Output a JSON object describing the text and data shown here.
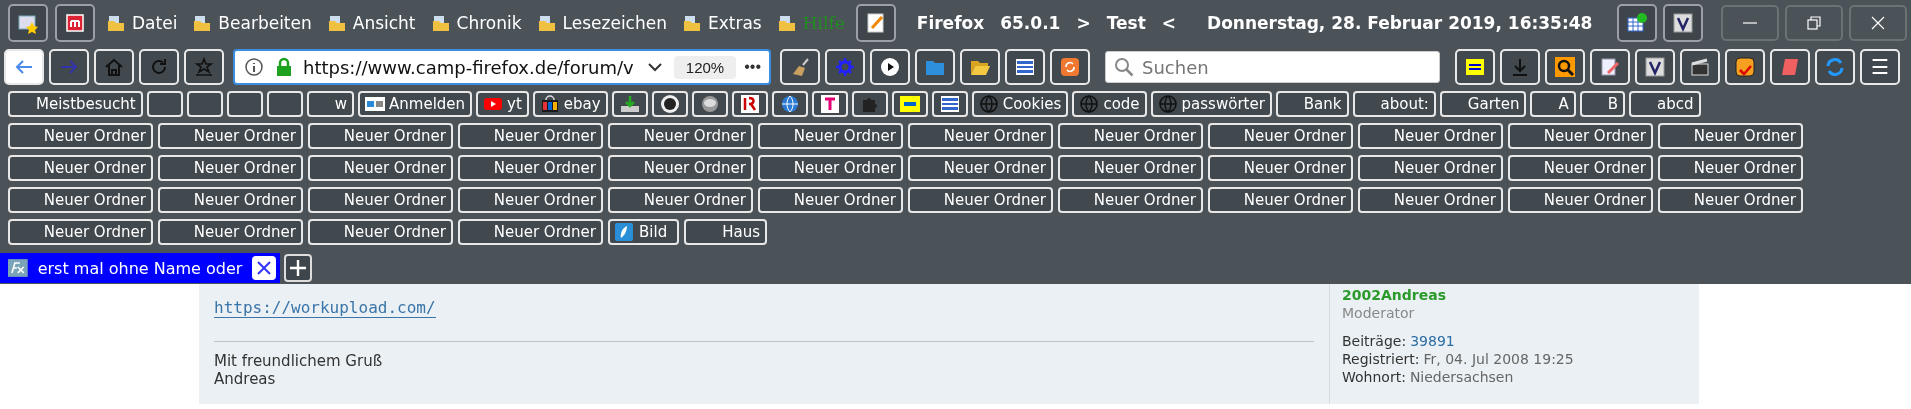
{
  "menubar": {
    "menus": [
      {
        "label": "Datei",
        "kind": "menu"
      },
      {
        "label": "Bearbeiten",
        "kind": "menu"
      },
      {
        "label": "Ansicht",
        "kind": "menu"
      },
      {
        "label": "Chronik",
        "kind": "menu"
      },
      {
        "label": "Lesezeichen",
        "kind": "menu"
      },
      {
        "label": "Extras",
        "kind": "menu"
      },
      {
        "label": "Hilfe",
        "kind": "help"
      }
    ],
    "title": {
      "app": "Firefox",
      "version": "65.0.1",
      "left_mark": ">",
      "profile": "Test",
      "right_mark": "<"
    },
    "datetime": "Donnerstag, 28. Februar 2019, 16:35:48"
  },
  "toolbar": {
    "url": "https://www.camp-firefox.de/forum/v",
    "zoom": "120%",
    "more": "•••",
    "search": {
      "placeholder": "Suchen"
    },
    "menu": "☰"
  },
  "bookmarks": [
    {
      "kind": "folder",
      "label": "Meistbesucht"
    },
    {
      "kind": "folder"
    },
    {
      "kind": "folder"
    },
    {
      "kind": "folder"
    },
    {
      "kind": "folder"
    },
    {
      "kind": "folder",
      "label": "w"
    },
    {
      "kind": "wp",
      "label": "Anmelden"
    },
    {
      "kind": "youtube",
      "label": "yt"
    },
    {
      "kind": "shop",
      "label": "ebay"
    },
    {
      "kind": "download"
    },
    {
      "kind": "github"
    },
    {
      "kind": "disc"
    },
    {
      "kind": "logo"
    },
    {
      "kind": "globe-blue"
    },
    {
      "kind": "telekom"
    },
    {
      "kind": "puzzle"
    },
    {
      "kind": "b64"
    },
    {
      "kind": "list"
    },
    {
      "kind": "globe",
      "label": "Cookies"
    },
    {
      "kind": "globe",
      "label": "code"
    },
    {
      "kind": "globe",
      "label": "passwörter"
    },
    {
      "kind": "folder",
      "label": "Bank"
    },
    {
      "kind": "folder",
      "label": "about:"
    },
    {
      "kind": "folder",
      "label": "Garten"
    },
    {
      "kind": "folder",
      "label": "A"
    },
    {
      "kind": "folder",
      "label": "B"
    },
    {
      "kind": "folder",
      "label": "abcd"
    }
  ],
  "folder_rows": [
    [
      {
        "kind": "folder",
        "label": "Neuer Ordner"
      },
      {
        "kind": "folder",
        "label": "Neuer Ordner"
      },
      {
        "kind": "folder",
        "label": "Neuer Ordner"
      },
      {
        "kind": "folder",
        "label": "Neuer Ordner"
      },
      {
        "kind": "folder",
        "label": "Neuer Ordner"
      },
      {
        "kind": "folder",
        "label": "Neuer Ordner"
      },
      {
        "kind": "folder",
        "label": "Neuer Ordner"
      },
      {
        "kind": "folder",
        "label": "Neuer Ordner"
      },
      {
        "kind": "folder",
        "label": "Neuer Ordner"
      },
      {
        "kind": "folder",
        "label": "Neuer Ordner"
      },
      {
        "kind": "folder",
        "label": "Neuer Ordner"
      },
      {
        "kind": "folder",
        "label": "Neuer Ordner"
      }
    ],
    [
      {
        "kind": "folder",
        "label": "Neuer Ordner"
      },
      {
        "kind": "folder",
        "label": "Neuer Ordner"
      },
      {
        "kind": "folder",
        "label": "Neuer Ordner"
      },
      {
        "kind": "folder",
        "label": "Neuer Ordner"
      },
      {
        "kind": "folder",
        "label": "Neuer Ordner"
      },
      {
        "kind": "folder",
        "label": "Neuer Ordner"
      },
      {
        "kind": "folder",
        "label": "Neuer Ordner"
      },
      {
        "kind": "folder",
        "label": "Neuer Ordner"
      },
      {
        "kind": "folder",
        "label": "Neuer Ordner"
      },
      {
        "kind": "folder",
        "label": "Neuer Ordner"
      },
      {
        "kind": "folder",
        "label": "Neuer Ordner"
      },
      {
        "kind": "folder",
        "label": "Neuer Ordner"
      }
    ],
    [
      {
        "kind": "folder",
        "label": "Neuer Ordner"
      },
      {
        "kind": "folder",
        "label": "Neuer Ordner"
      },
      {
        "kind": "folder",
        "label": "Neuer Ordner"
      },
      {
        "kind": "folder",
        "label": "Neuer Ordner"
      },
      {
        "kind": "folder",
        "label": "Neuer Ordner"
      },
      {
        "kind": "folder",
        "label": "Neuer Ordner"
      },
      {
        "kind": "folder",
        "label": "Neuer Ordner"
      },
      {
        "kind": "folder",
        "label": "Neuer Ordner"
      },
      {
        "kind": "folder",
        "label": "Neuer Ordner"
      },
      {
        "kind": "folder",
        "label": "Neuer Ordner"
      },
      {
        "kind": "folder",
        "label": "Neuer Ordner"
      },
      {
        "kind": "folder",
        "label": "Neuer Ordner"
      }
    ],
    [
      {
        "kind": "folder",
        "label": "Neuer Ordner"
      },
      {
        "kind": "folder",
        "label": "Neuer Ordner"
      },
      {
        "kind": "folder",
        "label": "Neuer Ordner"
      },
      {
        "kind": "folder",
        "label": "Neuer Ordner"
      },
      {
        "kind": "bookmark",
        "label": "Bild"
      },
      {
        "kind": "folder",
        "label": "Haus"
      }
    ]
  ],
  "tabs": [
    {
      "label": "erst mal ohne Name oder",
      "selected": true
    }
  ],
  "post": {
    "link": "https://workupload.com/",
    "greeting": "Mit freundlichem Gruß",
    "signature": "Andreas",
    "author": {
      "name": "2002Andreas",
      "rank": "Moderator",
      "fields": [
        {
          "label": "Beiträge:",
          "value": "39891",
          "kind": "link"
        },
        {
          "label": "Registriert:",
          "value": "Fr, 04. Jul 2008 19:25",
          "kind": "text"
        },
        {
          "label": "Wohnort:",
          "value": "Niedersachsen",
          "kind": "text"
        }
      ]
    }
  }
}
